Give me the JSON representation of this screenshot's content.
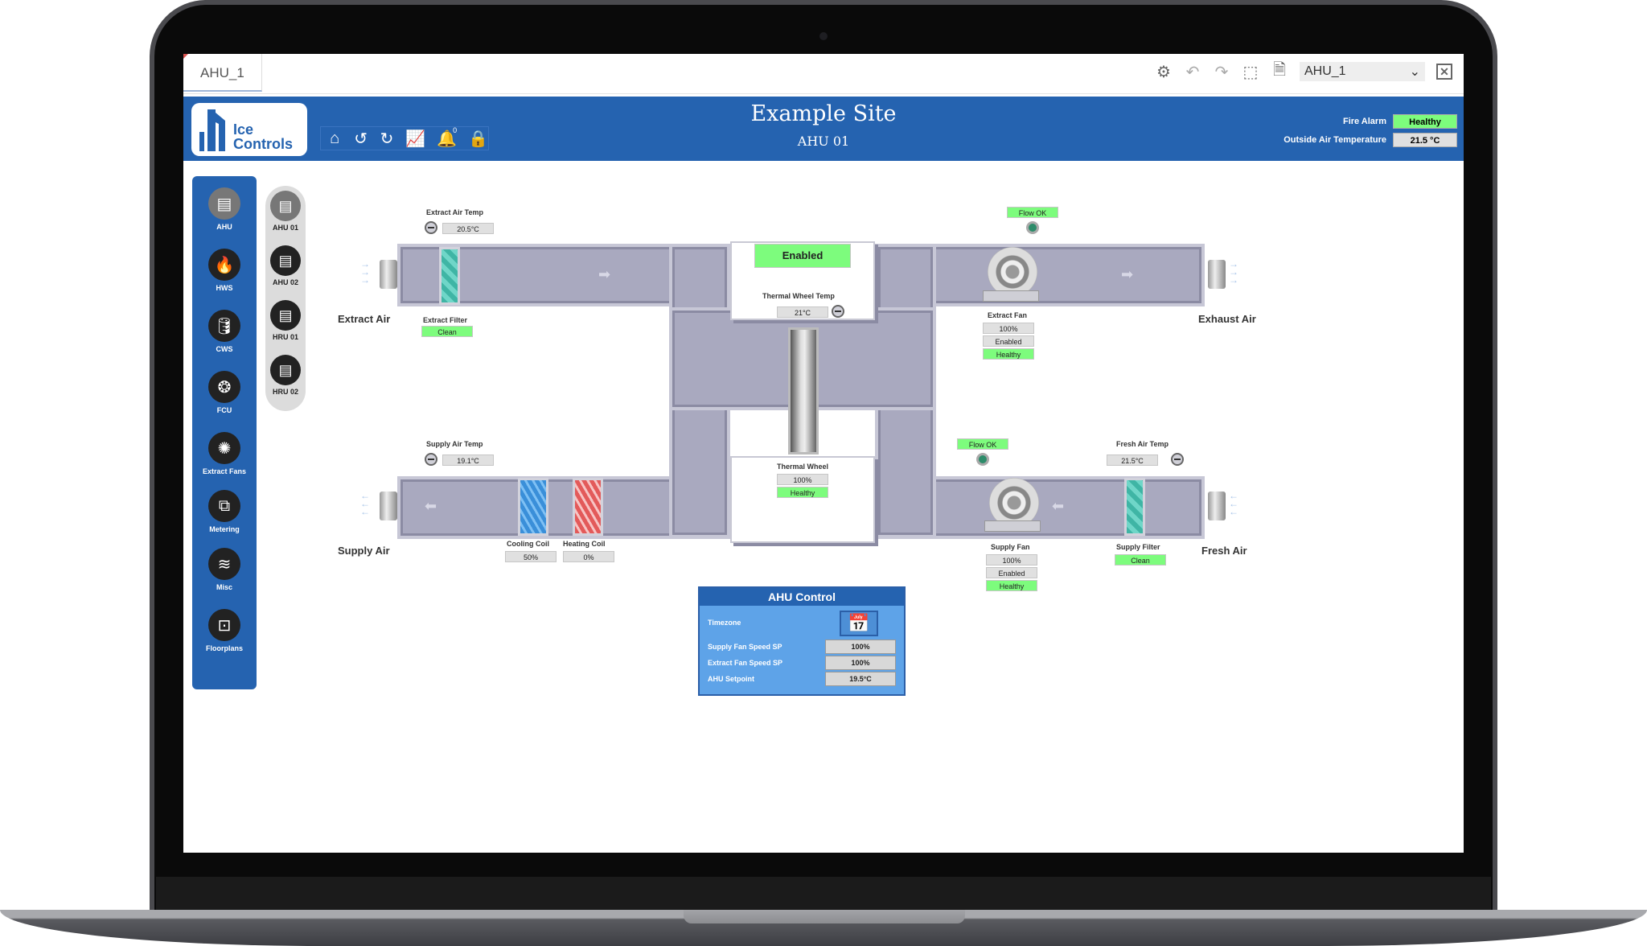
{
  "window": {
    "tab_label": "AHU_1",
    "selector_value": "AHU_1",
    "toolbar_icons": [
      "gear-icon",
      "undo-icon",
      "redo-icon",
      "select-icon",
      "export-icon",
      "close-icon"
    ]
  },
  "header": {
    "logo_line1": "Ice",
    "logo_line2": "Controls",
    "site_title": "Example Site",
    "site_subtitle": "AHU 01",
    "alarm_count": "0",
    "nav_icons": [
      "home-icon",
      "back-icon",
      "forward-icon",
      "trend-icon",
      "bell-icon",
      "lock-icon"
    ],
    "fire_alarm_label": "Fire Alarm",
    "fire_alarm_value": "Healthy",
    "oat_label": "Outside Air Temperature",
    "oat_value": "21.5 °C"
  },
  "sidebar": {
    "items": [
      {
        "label": "AHU",
        "icon": "ahu-icon"
      },
      {
        "label": "HWS",
        "icon": "flame-icon"
      },
      {
        "label": "CWS",
        "icon": "water-tank-icon"
      },
      {
        "label": "FCU",
        "icon": "fcu-icon"
      },
      {
        "label": "Extract Fans",
        "icon": "fan-icon"
      },
      {
        "label": "Metering",
        "icon": "metering-icon"
      },
      {
        "label": "Misc",
        "icon": "layers-icon"
      },
      {
        "label": "Floorplans",
        "icon": "floorplan-icon"
      }
    ],
    "sub_items": [
      {
        "label": "AHU 01"
      },
      {
        "label": "AHU 02"
      },
      {
        "label": "HRU 01"
      },
      {
        "label": "HRU 02"
      }
    ]
  },
  "diagram": {
    "extract_air_label": "Extract Air",
    "exhaust_air_label": "Exhaust Air",
    "supply_air_label": "Supply Air",
    "fresh_air_label": "Fresh Air",
    "extract_air_temp_label": "Extract Air Temp",
    "extract_air_temp": "20.5°C",
    "extract_filter_label": "Extract Filter",
    "extract_filter_status": "Clean",
    "unit_status": "Enabled",
    "thermal_wheel_temp_label": "Thermal Wheel Temp",
    "thermal_wheel_temp": "21°C",
    "thermal_wheel_label": "Thermal Wheel",
    "thermal_wheel_speed": "100%",
    "thermal_wheel_status": "Healthy",
    "extract_flow_status": "Flow OK",
    "extract_fan_label": "Extract Fan",
    "extract_fan_speed": "100%",
    "extract_fan_state": "Enabled",
    "extract_fan_status": "Healthy",
    "supply_air_temp_label": "Supply Air Temp",
    "supply_air_temp": "19.1°C",
    "cooling_coil_label": "Cooling Coil",
    "cooling_coil_value": "50%",
    "heating_coil_label": "Heating Coil",
    "heating_coil_value": "0%",
    "supply_flow_status": "Flow OK",
    "supply_fan_label": "Supply Fan",
    "supply_fan_speed": "100%",
    "supply_fan_state": "Enabled",
    "supply_fan_status": "Healthy",
    "fresh_air_temp_label": "Fresh Air Temp",
    "fresh_air_temp": "21.5°C",
    "supply_filter_label": "Supply Filter",
    "supply_filter_status": "Clean"
  },
  "ahu_control": {
    "title": "AHU Control",
    "timezone_label": "Timezone",
    "supply_fan_sp_label": "Supply Fan Speed SP",
    "supply_fan_sp_value": "100%",
    "extract_fan_sp_label": "Extract Fan Speed SP",
    "extract_fan_sp_value": "100%",
    "setpoint_label": "AHU Setpoint",
    "setpoint_value": "19.5°C"
  },
  "colors": {
    "brand_blue": "#2563b0",
    "healthy_green": "#7dfc7d",
    "duct": "#a9a9bf"
  }
}
